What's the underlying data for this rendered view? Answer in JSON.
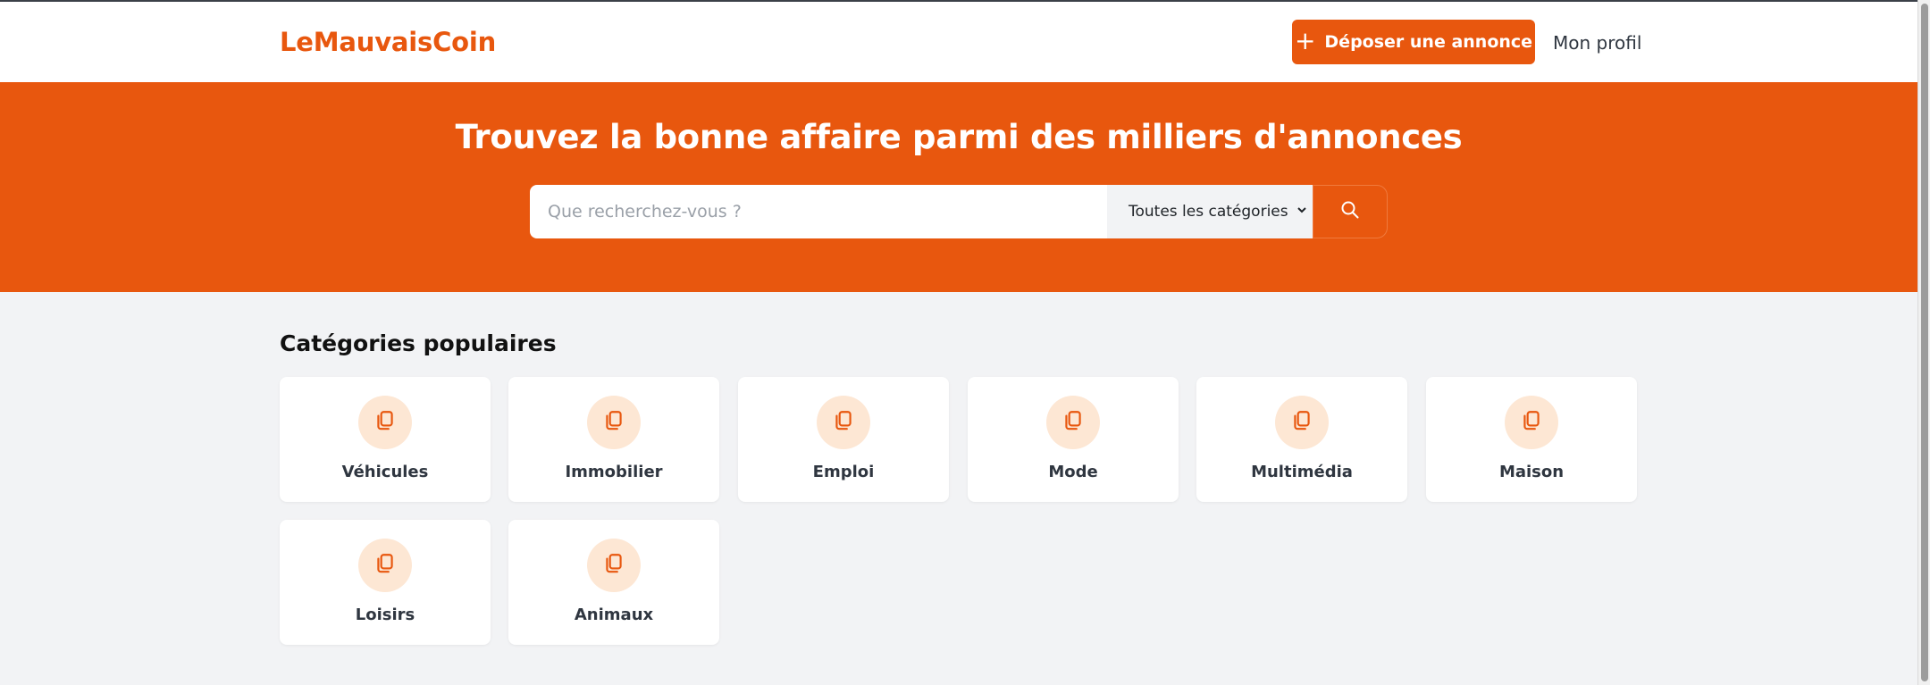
{
  "header": {
    "logo": "LeMauvaisCoin",
    "post_button": {
      "icon": "plus-icon",
      "label": "Déposer une annonce"
    },
    "profile_link": "Mon profil"
  },
  "hero": {
    "title": "Trouvez la bonne affaire parmi des milliers d'annonces",
    "search": {
      "placeholder": "Que recherchez-vous ?",
      "value": "",
      "category_selected": "Toutes les catégories",
      "button_icon": "search-icon"
    }
  },
  "popular": {
    "title": "Catégories populaires",
    "categories": [
      {
        "label": "Véhicules",
        "icon": "copy-icon"
      },
      {
        "label": "Immobilier",
        "icon": "copy-icon"
      },
      {
        "label": "Emploi",
        "icon": "copy-icon"
      },
      {
        "label": "Mode",
        "icon": "copy-icon"
      },
      {
        "label": "Multimédia",
        "icon": "copy-icon"
      },
      {
        "label": "Maison",
        "icon": "copy-icon"
      },
      {
        "label": "Loisirs",
        "icon": "copy-icon"
      },
      {
        "label": "Animaux",
        "icon": "copy-icon"
      }
    ]
  },
  "colors": {
    "brand": "#e8570e",
    "icon_bg": "#fde7d4",
    "page_bg": "#f2f3f5"
  }
}
